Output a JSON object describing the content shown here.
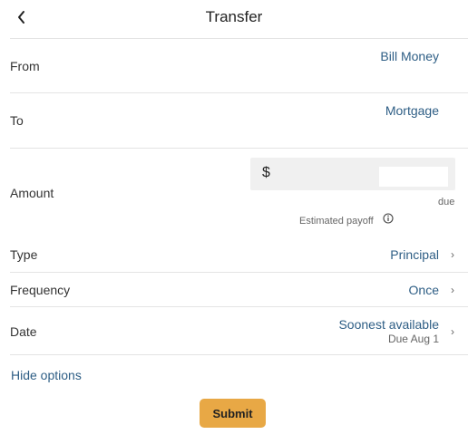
{
  "header": {
    "title": "Transfer",
    "back_icon": "chevron-left-icon"
  },
  "from": {
    "label": "From",
    "value": "Bill Money"
  },
  "to": {
    "label": "To",
    "value": "Mortgage"
  },
  "amount": {
    "label": "Amount",
    "currency_symbol": "$",
    "value": "",
    "due_text": "due",
    "payoff_text": "Estimated payoff",
    "info_icon": "info-circle-icon"
  },
  "type": {
    "label": "Type",
    "value": "Principal",
    "chevron": "›"
  },
  "frequency": {
    "label": "Frequency",
    "value": "Once",
    "chevron": "›"
  },
  "date": {
    "label": "Date",
    "value": "Soonest available",
    "sub_value": "Due Aug 1",
    "chevron": "›"
  },
  "hide_options": "Hide options",
  "submit_label": "Submit",
  "colors": {
    "accent_link": "#2e5e85",
    "submit_bg": "#e8a845",
    "divider": "#e4e4e4"
  }
}
